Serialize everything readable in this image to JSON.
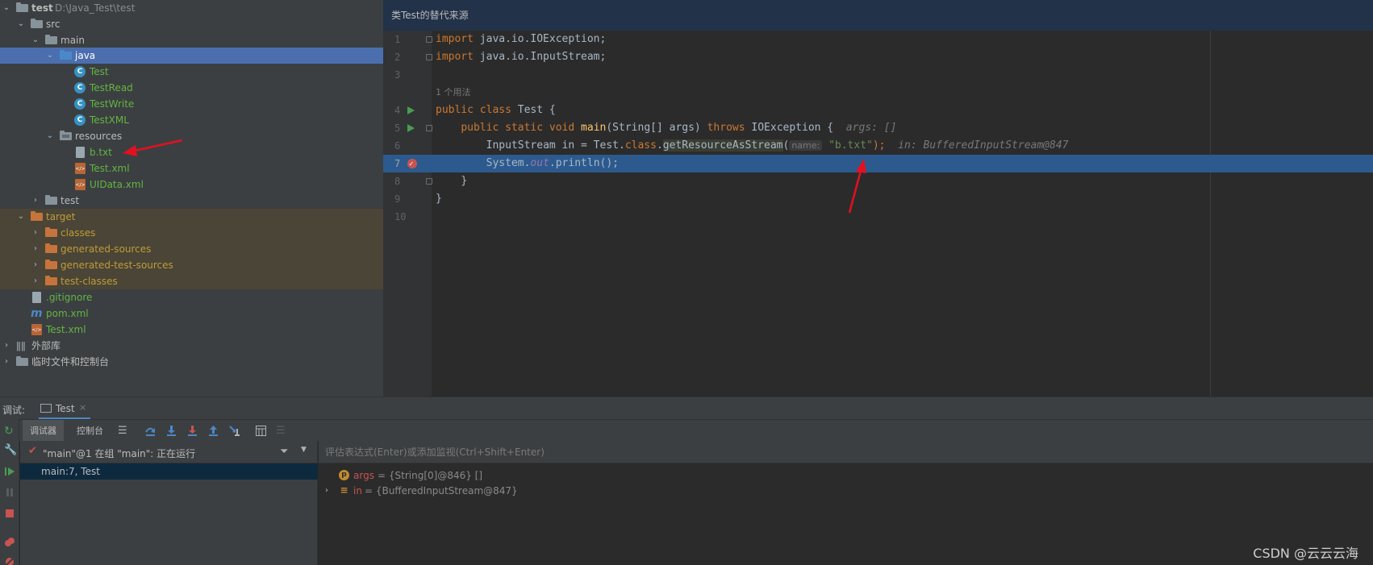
{
  "project_tree": {
    "root_name": "test",
    "root_path": "D:\\Java_Test\\test",
    "src": "src",
    "main": "main",
    "java": "java",
    "classes": [
      "Test",
      "TestRead",
      "TestWrite",
      "TestXML"
    ],
    "resources": "resources",
    "resource_files": [
      "b.txt",
      "Test.xml",
      "UIData.xml"
    ],
    "test_folder": "test",
    "target": "target",
    "target_children": [
      "classes",
      "generated-sources",
      "generated-test-sources",
      "test-classes"
    ],
    "root_files": [
      ".gitignore",
      "pom.xml",
      "Test.xml"
    ],
    "external_libs": "外部库",
    "scratches": "临时文件和控制台"
  },
  "editor": {
    "header": "类Test的替代来源",
    "usages": "1 个用法",
    "line_numbers": [
      "1",
      "2",
      "3",
      "4",
      "5",
      "6",
      "7",
      "8",
      "9",
      "10"
    ],
    "line1": {
      "kw": "import",
      "rest": " java.io.IOException;"
    },
    "line2": {
      "kw": "import",
      "rest": " java.io.InputStream;"
    },
    "line4": {
      "kw1": "public",
      "kw2": "class",
      "name": " Test {"
    },
    "line5": {
      "kw1": "public",
      "kw2": "static",
      "kw3": "void",
      "fn": "main",
      "params": "(String[] args) ",
      "kw4": "throws",
      "ex": " IOException {",
      "hint": "args: []"
    },
    "line6": {
      "start": "InputStream in = Test.",
      "kw": "class",
      "dot": ".",
      "method": "getResourceAsStream",
      "paren": "(",
      "param_hint": "name:",
      "str": "\"b.txt\"",
      "end": ");",
      "hint": "in: BufferedInputStream@847"
    },
    "line7": {
      "start": "System.",
      "field": "out",
      "end": ".println();"
    },
    "line8": "}",
    "line9": "}"
  },
  "debug": {
    "title": "调试:",
    "tab": "Test",
    "tab_close": "×",
    "subtabs": [
      "调试器",
      "控制台"
    ],
    "thread": "\"main\"@1 在组 \"main\": 正在运行",
    "frame": "main:7, Test",
    "eval_placeholder": "评估表达式(Enter)或添加监视(Ctrl+Shift+Enter)",
    "variables": [
      {
        "badge": "p",
        "name": "args",
        "value": " = {String[0]@846} []"
      },
      {
        "badge": "≡",
        "name": "in",
        "value": " = {BufferedInputStream@847}"
      }
    ]
  },
  "watermark": "CSDN @云云云海",
  "colors": {
    "selection": "#4b6eaf",
    "exec_line": "#2d5a8e",
    "keyword": "#cc7832",
    "string": "#6a8759",
    "annotation_arrow": "#e3101f"
  }
}
